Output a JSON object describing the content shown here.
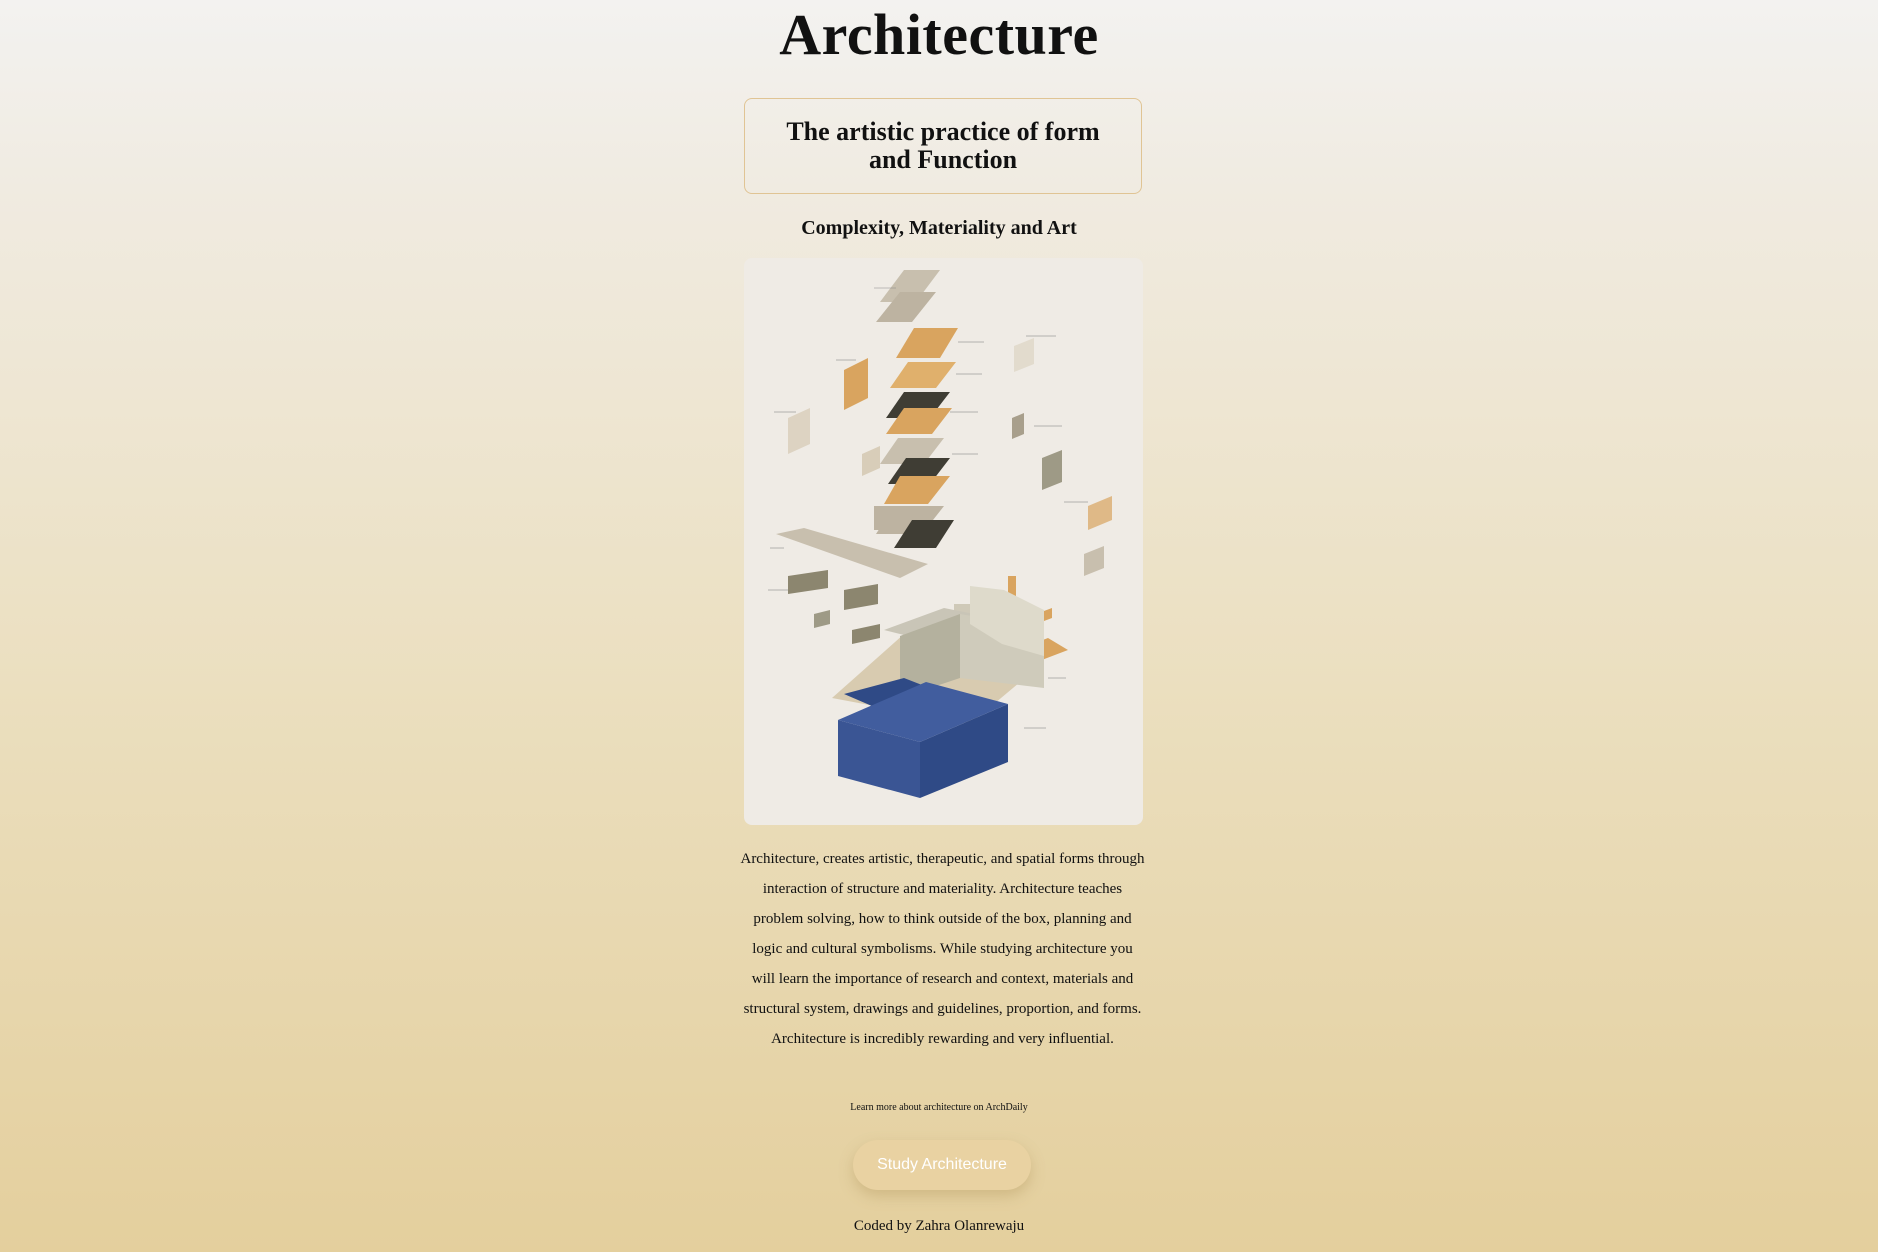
{
  "header": {
    "title": "Architecture"
  },
  "tagline": {
    "text": "The artistic practice of form and Function"
  },
  "subtitle": {
    "text": "Complexity, Materiality and Art"
  },
  "figure": {
    "description_icon": "exploded-axonometric-drawing",
    "colors": {
      "background": "#efebe5",
      "stone": "#c8bfae",
      "wood": "#d9a45f",
      "dark": "#3f3d34",
      "water": "#2f4a86"
    }
  },
  "description": {
    "text": "Architecture, creates artistic, therapeutic, and spatial forms through interaction of structure and materiality. Architecture teaches problem solving, how to think outside of the box, planning and logic and cultural symbolisms. While studying architecture you will learn the importance of research and context, materials and structural system, drawings and guidelines, proportion, and forms. Architecture is incredibly rewarding and very influential."
  },
  "learn_more": {
    "text": "Learn more about architecture on ArchDaily"
  },
  "cta": {
    "label": "Study Architecture"
  },
  "footer": {
    "text": "Coded by Zahra Olanrewaju"
  },
  "colors": {
    "gradient_top": "#f3f2f0",
    "gradient_bottom": "#e4cf9d",
    "tagline_border": "#e0c494",
    "button_bg": "#e9d2a2",
    "button_text": "#ffffff"
  }
}
